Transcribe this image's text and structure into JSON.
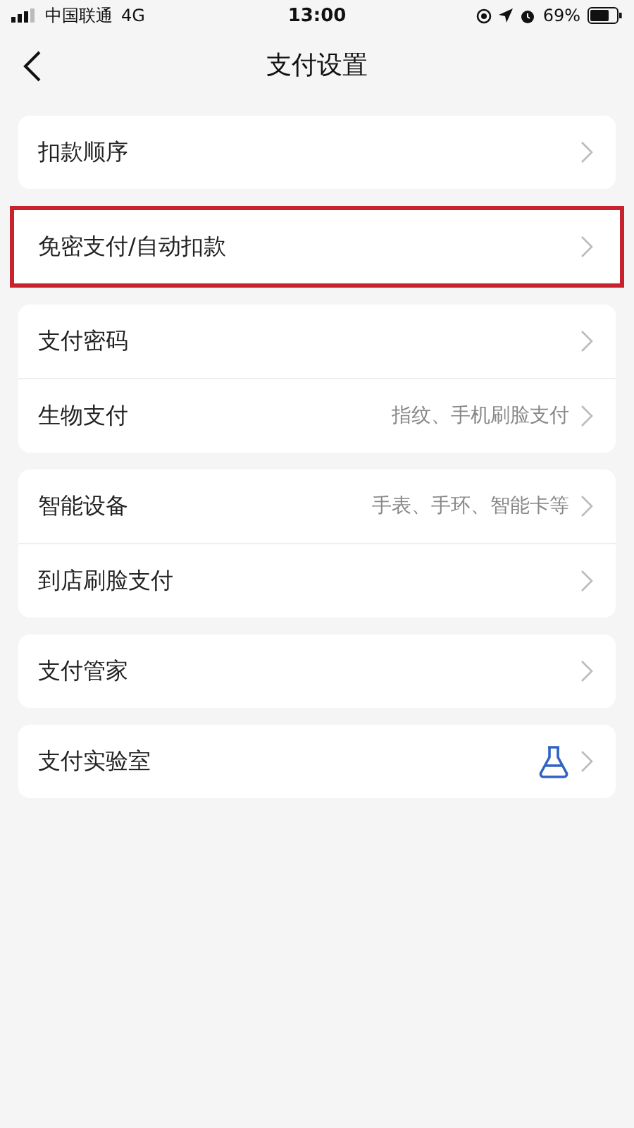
{
  "status_bar": {
    "carrier": "中国联通",
    "network": "4G",
    "time": "13:00",
    "battery": "69%"
  },
  "nav": {
    "title": "支付设置"
  },
  "groups": [
    {
      "highlighted": false,
      "items": [
        {
          "kind": "plain",
          "label": "扣款顺序"
        }
      ]
    },
    {
      "highlighted": true,
      "items": [
        {
          "kind": "plain",
          "label": "免密支付/自动扣款"
        }
      ]
    },
    {
      "highlighted": false,
      "items": [
        {
          "kind": "plain",
          "label": "支付密码"
        },
        {
          "kind": "plain",
          "label": "生物支付",
          "detail": "指纹、手机刷脸支付"
        }
      ]
    },
    {
      "highlighted": false,
      "items": [
        {
          "kind": "plain",
          "label": "智能设备",
          "detail": "手表、手环、智能卡等"
        },
        {
          "kind": "plain",
          "label": "到店刷脸支付"
        }
      ]
    },
    {
      "highlighted": false,
      "items": [
        {
          "kind": "plain",
          "label": "支付管家"
        }
      ]
    },
    {
      "highlighted": false,
      "items": [
        {
          "kind": "flask",
          "label": "支付实验室"
        }
      ]
    }
  ]
}
